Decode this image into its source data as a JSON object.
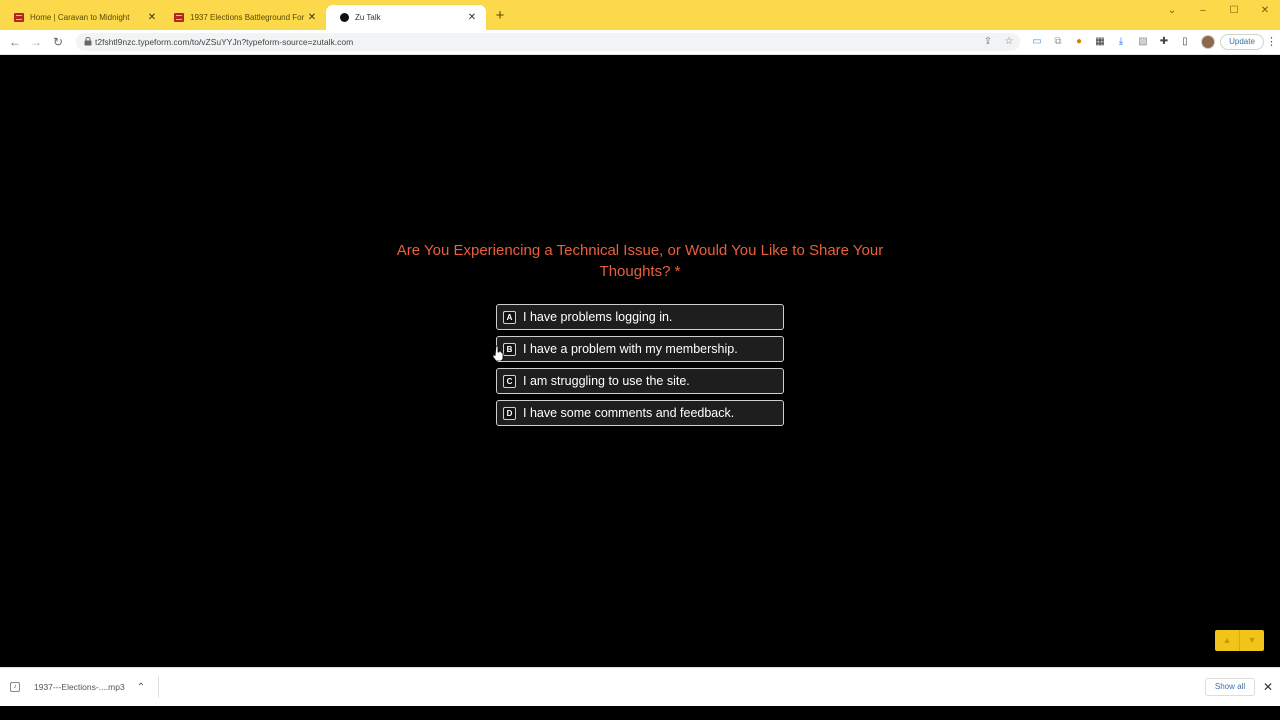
{
  "browser": {
    "tabs": [
      {
        "title": "Home | Caravan to Midnight",
        "favicon": "caravan-favicon",
        "active": false
      },
      {
        "title": "1937 Elections Battleground For",
        "favicon": "caravan-favicon",
        "active": false
      },
      {
        "title": "Zu Talk",
        "favicon": "zutalk-favicon",
        "active": true
      }
    ],
    "new_tab_icon": "+",
    "url": "t2fshtl9nzc.typeform.com/to/vZSuYYJn?typeform-source=zutalk.com",
    "update_label": "Update",
    "tab_strip_color": "#fbd94a"
  },
  "form": {
    "question": "Are You Experiencing a Technical Issue, or Would You Like to Share Your Thoughts? *",
    "question_color": "#e8603c",
    "choices": [
      {
        "key": "A",
        "label": "I have problems logging in."
      },
      {
        "key": "B",
        "label": "I have a problem with my membership."
      },
      {
        "key": "C",
        "label": "I am struggling to use the site."
      },
      {
        "key": "D",
        "label": "I have some comments and feedback."
      }
    ],
    "nav_color": "#f0c419"
  },
  "downloads": {
    "file_name": "1937---Elections-....mp3",
    "show_all_label": "Show all"
  }
}
